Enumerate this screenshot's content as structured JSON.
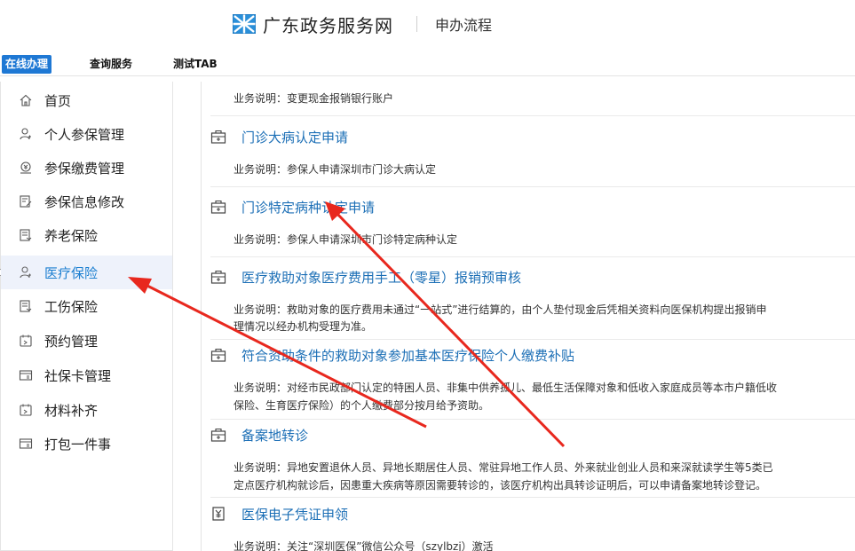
{
  "header": {
    "site_title": "广东政务服务网",
    "page_title": "申办流程"
  },
  "tabs": [
    {
      "label": "在线办理",
      "active": true
    },
    {
      "label": "查询服务",
      "active": false
    },
    {
      "label": "测试TAB",
      "active": false
    }
  ],
  "sidebar": {
    "items": [
      {
        "label": "首页",
        "icon": "home-icon"
      },
      {
        "label": "个人参保管理",
        "icon": "person-icon"
      },
      {
        "label": "参保缴费管理",
        "icon": "payment-icon"
      },
      {
        "label": "参保信息修改",
        "icon": "edit-icon"
      },
      {
        "label": "养老保险",
        "icon": "document-icon"
      },
      {
        "label": "医疗保险",
        "icon": "person-icon",
        "active": true
      },
      {
        "label": "工伤保险",
        "icon": "document-icon"
      },
      {
        "label": "预约管理",
        "icon": "calendar-icon"
      },
      {
        "label": "社保卡管理",
        "icon": "card-icon"
      },
      {
        "label": "材料补齐",
        "icon": "calendar-icon"
      },
      {
        "label": "打包一件事",
        "icon": "card-icon"
      }
    ]
  },
  "main": {
    "top_desc": "业务说明：变更现金报销银行账户",
    "entries": [
      {
        "title": "门诊大病认定申请",
        "icon": "medical-kit-icon",
        "desc": [
          "业务说明：参保人申请深圳市门诊大病认定"
        ]
      },
      {
        "title": "门诊特定病种认定申请",
        "icon": "medical-kit-icon",
        "desc": [
          "业务说明：参保人申请深圳市门诊特定病种认定"
        ]
      },
      {
        "title": "医疗救助对象医疗费用手工（零星）报销预审核",
        "icon": "medical-kit-icon",
        "desc": [
          "业务说明：救助对象的医疗费用未通过“一站式”进行结算的，由个人垫付现金后凭相关资料向医保机构提出报销申",
          "理情况以经办机构受理为准。"
        ]
      },
      {
        "title": "符合资助条件的救助对象参加基本医疗保险个人缴费补贴",
        "icon": "medical-kit-icon",
        "desc": [
          "业务说明：对经市民政部门认定的特困人员、非集中供养孤儿、最低生活保障对象和低收入家庭成员等本市户籍低收",
          "保险、生育医疗保险）的个人缴费部分按月给予资助。"
        ]
      },
      {
        "title": "备案地转诊",
        "icon": "medical-kit-icon",
        "desc": [
          "业务说明：异地安置退休人员、异地长期居住人员、常驻异地工作人员、外来就业创业人员和来深就读学生等5类已",
          "定点医疗机构就诊后，因患重大疾病等原因需要转诊的，该医疗机构出具转诊证明后，可以申请备案地转诊登记。"
        ]
      },
      {
        "title": "医保电子凭证申领",
        "icon": "yuan-receipt-icon",
        "desc": [
          "业务说明：关注“深圳医保”微信公众号（szylbzj）激活"
        ]
      }
    ]
  },
  "colors": {
    "accent": "#1e78d4",
    "link": "#1c6fb6",
    "annotation_arrow": "#e8281e"
  }
}
